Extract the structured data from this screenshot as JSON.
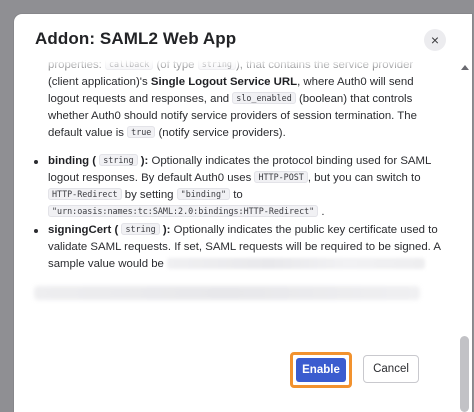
{
  "dialog": {
    "title": "Addon: SAML2 Web App",
    "close_symbol": "×"
  },
  "content": {
    "intro_lines": {
      "l1a": "properties:",
      "l1code": "callback",
      "l1b": "(of type",
      "l1code2": "string",
      "l1c": "), that contains the service provider",
      "l2a": "(client application)'s",
      "l2b": "Single Logout Service URL",
      "l2c": ", where Auth0 will send",
      "l3a": "logout requests and responses, and",
      "l3code": "slo_enabled",
      "l3b": "(boolean) that controls",
      "l4": "whether Auth0 should notify service providers of session termination. The",
      "l5a": "default value is",
      "l5code": "true",
      "l5b": "(notify service providers)."
    },
    "binding": {
      "name": "binding",
      "paren_open": "(",
      "type": "string",
      "paren_close": "):",
      "l1rest": "Optionally indicates the protocol binding used for SAML",
      "l2a": "logout responses. By default Auth0 uses",
      "l2code": "HTTP-POST",
      "l2b": ", but you can switch to",
      "l3code": "HTTP-Redirect",
      "l3a": "by setting",
      "l3code2": "\"binding\"",
      "l3b": "to",
      "l4code": "\"urn:oasis:names:tc:SAML:2.0:bindings:HTTP-Redirect\"",
      "l4b": "."
    },
    "signing": {
      "name": "signingCert",
      "paren_open": "(",
      "type": "string",
      "paren_close": "):",
      "l1rest": "Optionally indicates the public key certificate used to",
      "l2": "validate SAML requests. If set, SAML requests will be required to be signed. A",
      "l3": "sample value would be"
    }
  },
  "footer": {
    "enable_label": "Enable",
    "cancel_label": "Cancel"
  },
  "colors": {
    "primary": "#3b5ccf",
    "highlight": "#f2922e"
  }
}
